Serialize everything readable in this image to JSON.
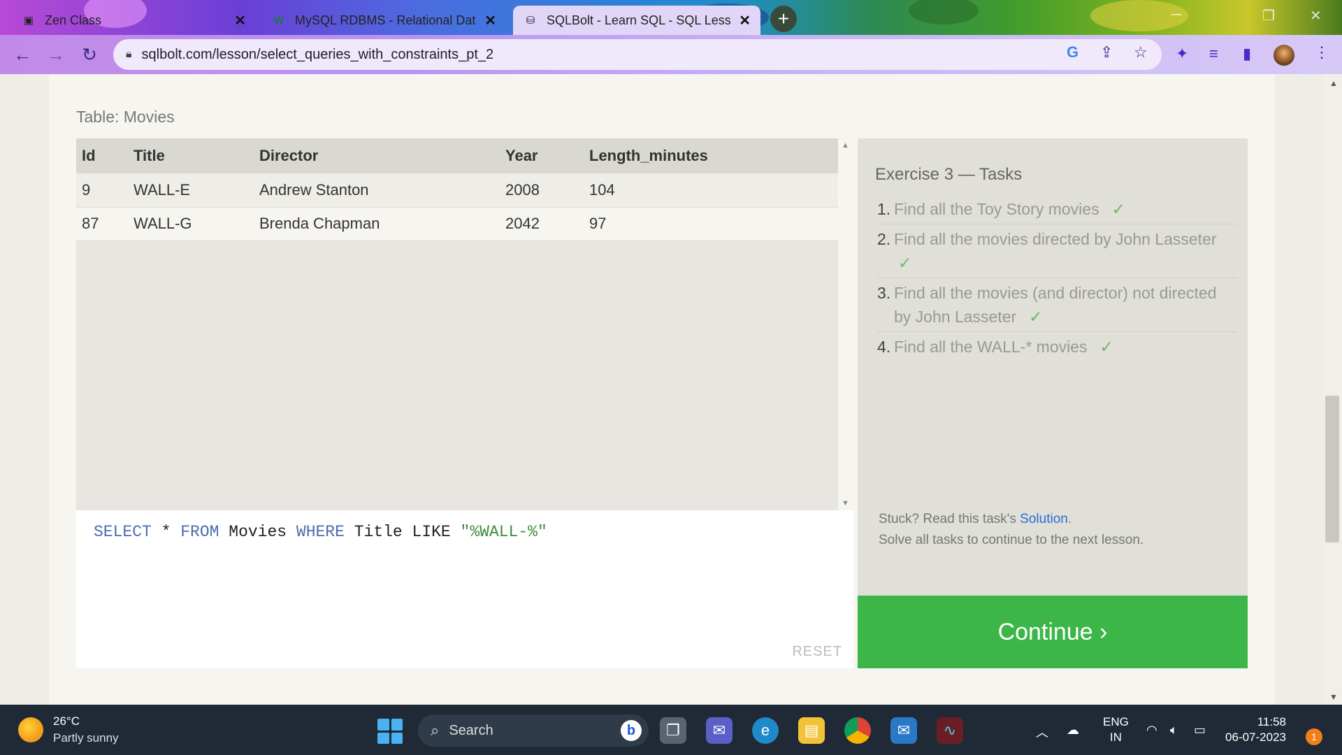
{
  "browser": {
    "tabs": [
      {
        "title": "Zen Class",
        "icon": "zen-class-icon",
        "active": false
      },
      {
        "title": "MySQL RDBMS - Relational Data",
        "icon": "w3-icon",
        "active": false
      },
      {
        "title": "SQLBolt - Learn SQL - SQL Lesso",
        "icon": "database-icon",
        "active": true
      }
    ],
    "new_tab_label": "+",
    "url": "sqlbolt.com/lesson/select_queries_with_constraints_pt_2"
  },
  "lesson": {
    "table_caption": "Table: Movies",
    "columns": [
      "Id",
      "Title",
      "Director",
      "Year",
      "Length_minutes"
    ],
    "rows": [
      {
        "id": "9",
        "title": "WALL-E",
        "director": "Andrew Stanton",
        "year": "2008",
        "length": "104"
      },
      {
        "id": "87",
        "title": "WALL-G",
        "director": "Brenda Chapman",
        "year": "2042",
        "length": "97"
      }
    ],
    "query": {
      "kw_select": "SELECT",
      "star": " * ",
      "kw_from": "FROM",
      "table": " Movies ",
      "kw_where": "WHERE",
      "condition": " Title LIKE ",
      "string": "\"%WALL-%\""
    },
    "reset_label": "RESET",
    "tasks_title": "Exercise 3 — Tasks",
    "tasks": [
      {
        "num": "1.",
        "text": "Find all the Toy Story movies",
        "check": "✓"
      },
      {
        "num": "2.",
        "text": "Find all the movies directed by John Lasseter",
        "check": "✓"
      },
      {
        "num": "3.",
        "text": "Find all the movies (and director) not directed by John Lasseter",
        "check": "✓"
      },
      {
        "num": "4.",
        "text": "Find all the WALL-* movies",
        "check": "✓"
      }
    ],
    "hint_prefix": "Stuck? Read this task's ",
    "hint_link": "Solution",
    "hint_suffix": ".",
    "hint_line2": "Solve all tasks to continue to the next lesson.",
    "continue_label": "Continue ›"
  },
  "taskbar": {
    "weather_temp": "26°C",
    "weather_desc": "Partly sunny",
    "search_placeholder": "Search",
    "lang_line1": "ENG",
    "lang_line2": "IN",
    "time": "11:58",
    "date": "06-07-2023",
    "notification_count": "1"
  }
}
